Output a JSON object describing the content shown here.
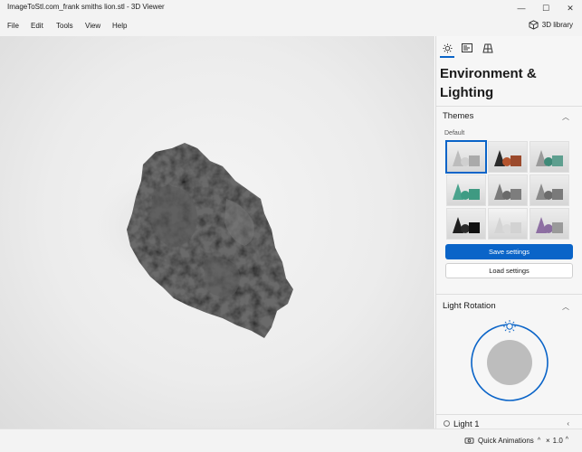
{
  "window": {
    "title": "ImageToStl.com_frank smiths lion.stl - 3D Viewer",
    "minimize": "—",
    "maximize": "☐",
    "close": "✕"
  },
  "menu": {
    "items": [
      "File",
      "Edit",
      "Tools",
      "View",
      "Help"
    ],
    "library_label": "3D library"
  },
  "panel": {
    "tabs": [
      "environment-tab",
      "stats-tab",
      "grid-tab"
    ],
    "title": "Environment & Lighting",
    "themes": {
      "heading": "Themes",
      "sub_label": "Default",
      "tiles": [
        {
          "cone": "#bcbcbc",
          "sphere": "#cfcfcf",
          "cube": "#aaaaaa",
          "bg": "#f0f0f0"
        },
        {
          "cone": "#2a2a2a",
          "sphere": "#b4542e",
          "cube": "#9b4a2c",
          "bg": "#ececec"
        },
        {
          "cone": "#9a9a9a",
          "sphere": "#3f8a78",
          "cube": "#5e9f8f",
          "bg": "#ececec"
        },
        {
          "cone": "#4aa38d",
          "sphere": "#3e9c84",
          "cube": "#3f9a82",
          "bg": "#f2f2f2"
        },
        {
          "cone": "#7a7a7a",
          "sphere": "#6a6a6a",
          "cube": "#7d7d7d",
          "bg": "#ececec"
        },
        {
          "cone": "#8a8a8a",
          "sphere": "#6c6c6c",
          "cube": "#7a7a7a",
          "bg": "#ececec"
        },
        {
          "cone": "#1e1e1e",
          "sphere": "#2a2a2a",
          "cube": "#111111",
          "bg": "#ededed"
        },
        {
          "cone": "#d4d4d4",
          "sphere": "#dadada",
          "cube": "#d2d2d2",
          "bg": "#f3f3f3"
        },
        {
          "cone": "#8e6fa3",
          "sphere": "#8b6ea0",
          "cube": "#9a9a9a",
          "bg": "#ececec"
        }
      ],
      "save_label": "Save settings",
      "load_label": "Load settings"
    },
    "light_rotation": {
      "heading": "Light Rotation"
    },
    "light1": {
      "heading": "Light 1"
    }
  },
  "status": {
    "quick_animations": "Quick Animations",
    "speed": "1.0",
    "speed_prefix": "×"
  },
  "colors": {
    "accent": "#0a64c8",
    "model": "#6b6b6b"
  }
}
